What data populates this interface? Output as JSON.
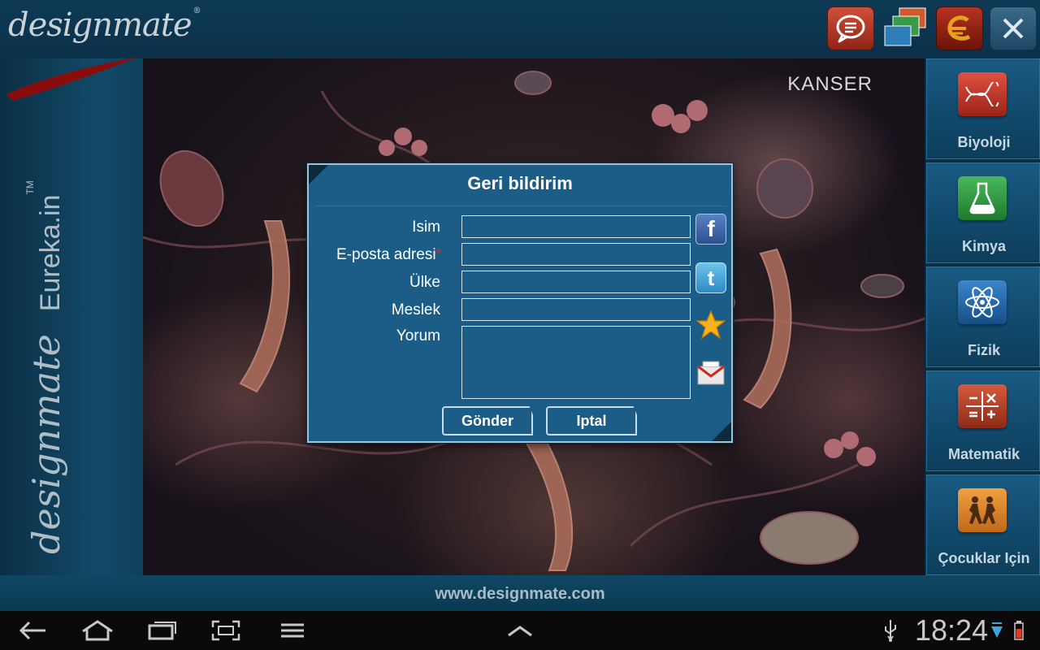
{
  "app": {
    "logo": "designmate",
    "logo_tm": "®",
    "side_brand_logo": "designmate",
    "side_brand_product": "Eureka.in",
    "side_brand_tm": "TM",
    "url": "www.designmate.com"
  },
  "topbar": {
    "buttons": [
      {
        "name": "feedback",
        "icon": "chat-bubble-icon"
      },
      {
        "name": "gallery",
        "icon": "stacked-cards-icon"
      },
      {
        "name": "eureka",
        "icon": "e-logo-icon"
      },
      {
        "name": "close",
        "icon": "close-icon"
      }
    ]
  },
  "main": {
    "title": "KANSER"
  },
  "categories": [
    {
      "label": "Biyoloji",
      "icon": "dna-icon",
      "color": "#c0392b"
    },
    {
      "label": "Kimya",
      "icon": "flask-icon",
      "color": "#2e8b3e"
    },
    {
      "label": "Fizik",
      "icon": "atom-icon",
      "color": "#1f5fa0"
    },
    {
      "label": "Matematik",
      "icon": "math-symbols-icon",
      "color": "#b83a24"
    },
    {
      "label": "Çocuklar Için",
      "icon": "children-icon",
      "color": "#d9822b"
    }
  ],
  "dialog": {
    "title": "Geri bildirim",
    "fields": {
      "name_label": "Isim",
      "email_label": "E-posta adresi",
      "email_required": "*",
      "country_label": "Ülke",
      "job_label": "Meslek",
      "comment_label": "Yorum",
      "name_value": "",
      "email_value": "",
      "country_value": "",
      "job_value": "",
      "comment_value": ""
    },
    "send_label": "Gönder",
    "cancel_label": "Iptal",
    "social": {
      "facebook_glyph": "f",
      "twitter_glyph": "t"
    }
  },
  "statusbar": {
    "clock": "18:24"
  }
}
